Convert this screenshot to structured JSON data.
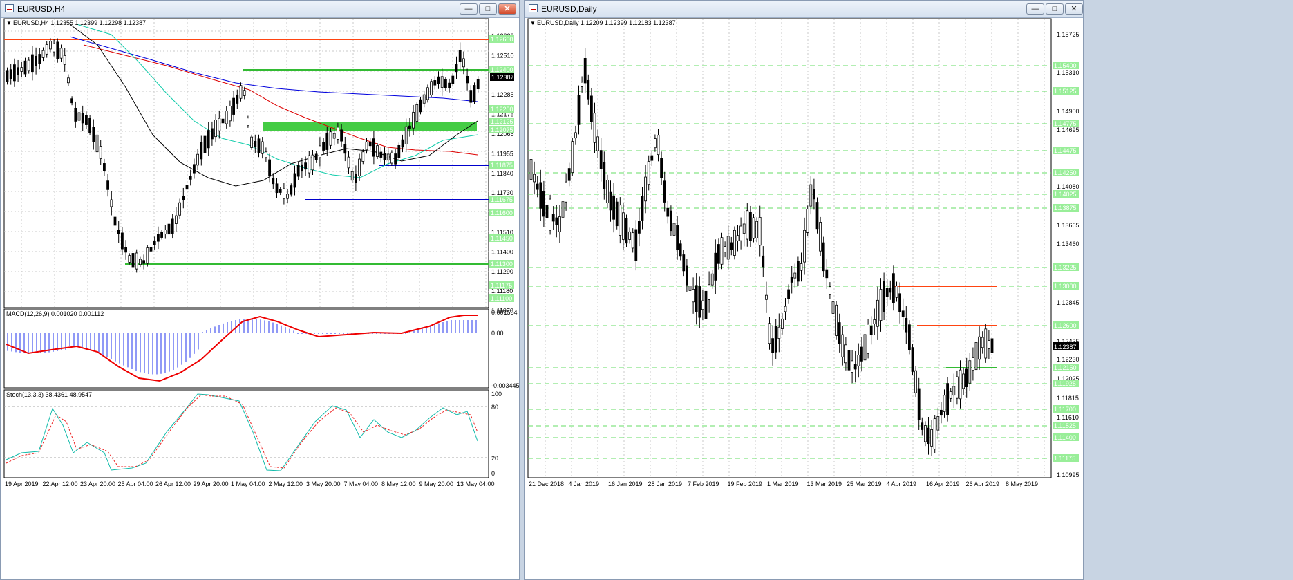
{
  "left_window": {
    "title": "EURUSD,H4",
    "info": "EURUSD,H4  1.12355 1.12399 1.12298 1.12387",
    "price_tag": "1.12387",
    "price_axis": [
      "1.12620",
      "1.12510",
      "1.12400",
      "1.12285",
      "1.12175",
      "1.12065",
      "1.11955",
      "1.11840",
      "1.11730",
      "1.11620",
      "1.11510",
      "1.11400",
      "1.11290",
      "1.11180",
      "1.11070"
    ],
    "level_tags": [
      "1.12600",
      "1.12400",
      "1.12200",
      "1.12125",
      "1.12075",
      "1.11875",
      "1.11675",
      "1.11600",
      "1.11450",
      "1.11300",
      "1.11175",
      "1.11100"
    ],
    "macd_label": "MACD(12,26,9) 0.001020 0.001112",
    "macd_axis": [
      "0.001554",
      "0.00",
      "-0.003445"
    ],
    "stoch_label": "Stoch(13,3,3) 38.4361 48.9547",
    "stoch_axis": [
      "100",
      "80",
      "20",
      "0"
    ],
    "time_axis": [
      "19 Apr 2019",
      "22 Apr 12:00",
      "23 Apr 20:00",
      "25 Apr 04:00",
      "26 Apr 12:00",
      "29 Apr 20:00",
      "1 May 04:00",
      "2 May 12:00",
      "3 May 20:00",
      "7 May 04:00",
      "8 May 12:00",
      "9 May 20:00",
      "13 May 04:00"
    ]
  },
  "right_window": {
    "title": "EURUSD,Daily",
    "info": "EURUSD,Daily  1.12209 1.12399 1.12183 1.12387",
    "price_tag": "1.12387",
    "price_axis": [
      "1.15725",
      "1.15310",
      "1.14900",
      "1.14695",
      "1.14080",
      "1.13665",
      "1.13460",
      "1.12845",
      "1.12435",
      "1.12230",
      "1.12025",
      "1.11815",
      "1.11610",
      "1.10995"
    ],
    "level_tags": [
      "1.15400",
      "1.15125",
      "1.14775",
      "1.14475",
      "1.14250",
      "1.14025",
      "1.13875",
      "1.13225",
      "1.13000",
      "1.12600",
      "1.12150",
      "1.11925",
      "1.11700",
      "1.11525",
      "1.11400",
      "1.11175"
    ],
    "time_axis": [
      "21 Dec 2018",
      "4 Jan 2019",
      "16 Jan 2019",
      "28 Jan 2019",
      "7 Feb 2019",
      "19 Feb 2019",
      "1 Mar 2019",
      "13 Mar 2019",
      "25 Mar 2019",
      "4 Apr 2019",
      "16 Apr 2019",
      "26 Apr 2019",
      "8 May 2019"
    ]
  },
  "colors": {
    "bull_body": "#ffffff",
    "bear_body": "#000000",
    "green_level": "#33bb33",
    "red_level": "#ff4411",
    "blue_level": "#0000cc",
    "tag_bg": "#99ee99"
  }
}
